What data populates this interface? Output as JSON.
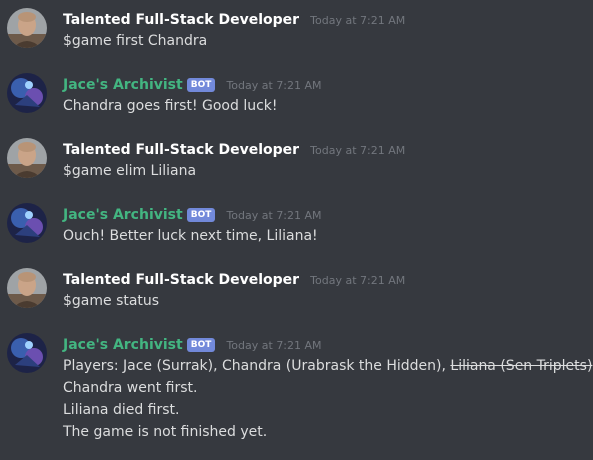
{
  "colors": {
    "background": "#36393f",
    "user_name": "#ffffff",
    "bot_name": "#43b581",
    "bot_tag_bg": "#7289da",
    "timestamp": "#72767d",
    "text": "#dcddde"
  },
  "messages": [
    {
      "author": "Talented Full-Stack Developer",
      "timestamp": "Today at 7:21 AM",
      "lines": [
        "$game first Chandra"
      ]
    },
    {
      "author": "Jace's Archivist",
      "bot_tag": "BOT",
      "timestamp": "Today at 7:21 AM",
      "lines": [
        "Chandra goes first!  Good luck!"
      ]
    },
    {
      "author": "Talented Full-Stack Developer",
      "timestamp": "Today at 7:21 AM",
      "lines": [
        "$game elim Liliana"
      ]
    },
    {
      "author": "Jace's Archivist",
      "bot_tag": "BOT",
      "timestamp": "Today at 7:21 AM",
      "lines": [
        "Ouch! Better luck next time, Liliana!"
      ]
    },
    {
      "author": "Talented Full-Stack Developer",
      "timestamp": "Today at 7:21 AM",
      "lines": [
        "$game status"
      ]
    },
    {
      "author": "Jace's Archivist",
      "bot_tag": "BOT",
      "timestamp": "Today at 7:21 AM",
      "players_prefix": "Players: Jace (Surrak), Chandra (Urabrask the Hidden), ",
      "players_struck": "Liliana (Sen Triplets)",
      "lines": [
        "Chandra went first.",
        "Liliana died first.",
        "The game is not finished yet."
      ]
    }
  ]
}
